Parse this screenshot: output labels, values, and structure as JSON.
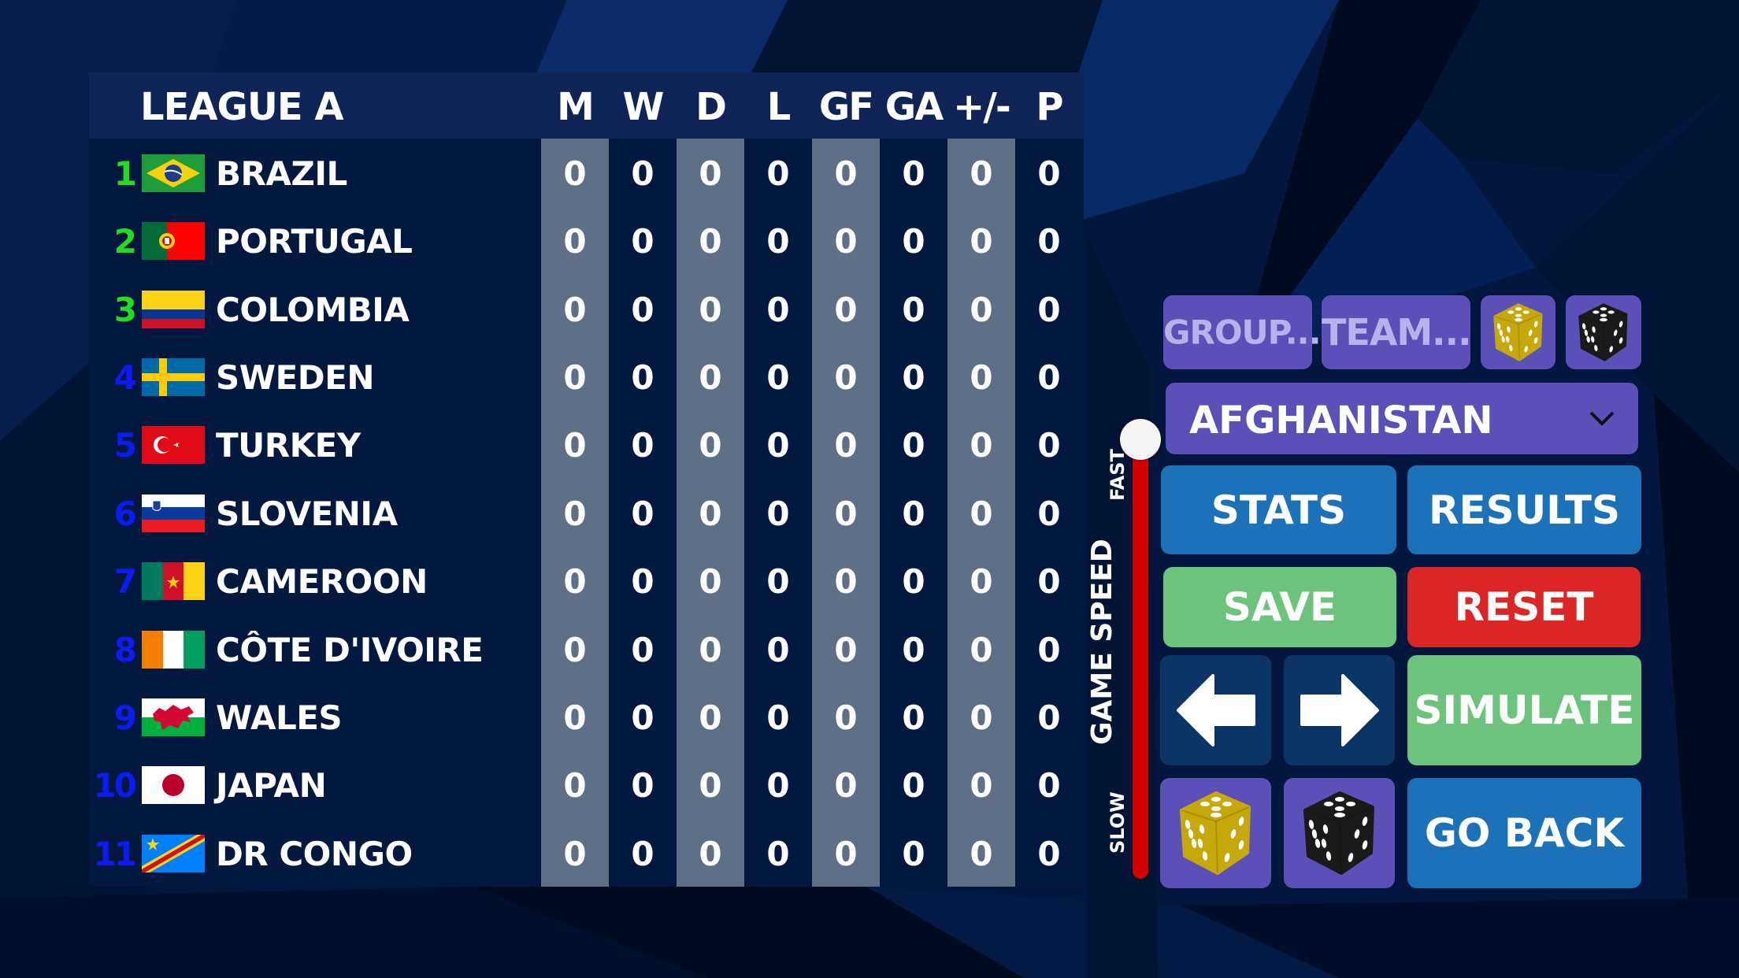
{
  "table": {
    "title": "LEAGUE A",
    "columns": [
      "M",
      "W",
      "D",
      "L",
      "GF",
      "GA",
      "+/-",
      "P"
    ],
    "rows": [
      {
        "rank": "1",
        "rank_color": "#22dd22",
        "team": "BRAZIL",
        "flag": "flag-brazil",
        "stats": [
          "0",
          "0",
          "0",
          "0",
          "0",
          "0",
          "0",
          "0"
        ]
      },
      {
        "rank": "2",
        "rank_color": "#22dd22",
        "team": "PORTUGAL",
        "flag": "flag-portugal",
        "stats": [
          "0",
          "0",
          "0",
          "0",
          "0",
          "0",
          "0",
          "0"
        ]
      },
      {
        "rank": "3",
        "rank_color": "#22dd22",
        "team": "COLOMBIA",
        "flag": "flag-colombia",
        "stats": [
          "0",
          "0",
          "0",
          "0",
          "0",
          "0",
          "0",
          "0"
        ]
      },
      {
        "rank": "4",
        "rank_color": "#0a1cf0",
        "team": "SWEDEN",
        "flag": "flag-sweden",
        "stats": [
          "0",
          "0",
          "0",
          "0",
          "0",
          "0",
          "0",
          "0"
        ]
      },
      {
        "rank": "5",
        "rank_color": "#0a1cf0",
        "team": "TURKEY",
        "flag": "flag-turkey",
        "stats": [
          "0",
          "0",
          "0",
          "0",
          "0",
          "0",
          "0",
          "0"
        ]
      },
      {
        "rank": "6",
        "rank_color": "#0a1cf0",
        "team": "SLOVENIA",
        "flag": "flag-slovenia",
        "stats": [
          "0",
          "0",
          "0",
          "0",
          "0",
          "0",
          "0",
          "0"
        ]
      },
      {
        "rank": "7",
        "rank_color": "#0a1cf0",
        "team": "CAMEROON",
        "flag": "flag-cameroon",
        "stats": [
          "0",
          "0",
          "0",
          "0",
          "0",
          "0",
          "0",
          "0"
        ]
      },
      {
        "rank": "8",
        "rank_color": "#0a1cf0",
        "team": "CÔTE D'IVOIRE",
        "flag": "flag-cote-divoire",
        "stats": [
          "0",
          "0",
          "0",
          "0",
          "0",
          "0",
          "0",
          "0"
        ]
      },
      {
        "rank": "9",
        "rank_color": "#0a1cf0",
        "team": "WALES",
        "flag": "flag-wales",
        "stats": [
          "0",
          "0",
          "0",
          "0",
          "0",
          "0",
          "0",
          "0"
        ]
      },
      {
        "rank": "10",
        "rank_color": "#0a1cf0",
        "team": "JAPAN",
        "flag": "flag-japan",
        "stats": [
          "0",
          "0",
          "0",
          "0",
          "0",
          "0",
          "0",
          "0"
        ]
      },
      {
        "rank": "11",
        "rank_color": "#0a1cf0",
        "team": "DR CONGO",
        "flag": "flag-dr-congo",
        "stats": [
          "0",
          "0",
          "0",
          "0",
          "0",
          "0",
          "0",
          "0"
        ]
      }
    ]
  },
  "game_speed": {
    "title": "GAME SPEED",
    "fast_label": "FAST",
    "slow_label": "SLOW",
    "value_percent": 100,
    "track_color": "#d40000"
  },
  "panel": {
    "group_button": "GROUP...",
    "team_button": "TEAM...",
    "team_select": {
      "selected": "AFGHANISTAN"
    },
    "stats_button": "STATS",
    "results_button": "RESULTS",
    "save_button": "SAVE",
    "reset_button": "RESET",
    "prev_icon": "arrow-left-icon",
    "next_icon": "arrow-right-icon",
    "simulate_button": "SIMULATE",
    "random_dice_gold_icon": "dice-gold-icon",
    "random_dice_black_icon": "dice-black-icon",
    "go_back_button": "GO BACK"
  },
  "colors": {
    "purple": "#5a50b8",
    "blue": "#1b72b8",
    "green": "#6cc47c",
    "red": "#dc2626",
    "navy": "#0b3566",
    "header": "#0f2356",
    "stripe": "#5f6f86"
  }
}
